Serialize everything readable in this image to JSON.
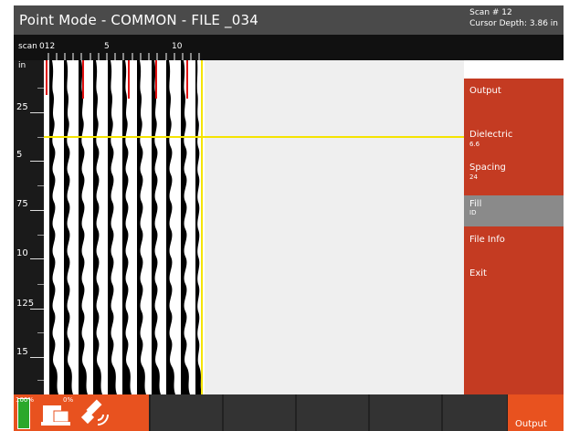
{
  "title_bar": {
    "title": "Point Mode - COMMON - FILE _034",
    "scan_number": "Scan # 12",
    "cursor_depth": "Cursor Depth: 3.86 in"
  },
  "scan_axis": {
    "label": "scan",
    "ticks": [
      "012",
      "5",
      "10"
    ]
  },
  "depth_ruler": {
    "unit": "in",
    "labels": [
      "25",
      "5",
      "75",
      "10",
      "125",
      "15"
    ]
  },
  "side_menu": {
    "header": "Output",
    "items": [
      {
        "label": "Dielectric",
        "value": "6.6",
        "active": false
      },
      {
        "label": "Spacing",
        "value": "24",
        "active": false
      },
      {
        "label": "Fill",
        "value": "ID",
        "active": true
      },
      {
        "label": "File Info",
        "value": "",
        "active": false
      },
      {
        "label": "Exit",
        "value": "",
        "active": false
      }
    ]
  },
  "status_bar": {
    "battery_percent": "100%",
    "scanner_percent": "0%",
    "output_button": "Output"
  },
  "colors": {
    "menu": "#c43b22",
    "accent": "#e8521f",
    "cursor_line": "#f5e400",
    "title_bg": "#4a4a4a"
  },
  "icons": [
    "battery-icon",
    "scanner-icon",
    "satellite-icon"
  ]
}
